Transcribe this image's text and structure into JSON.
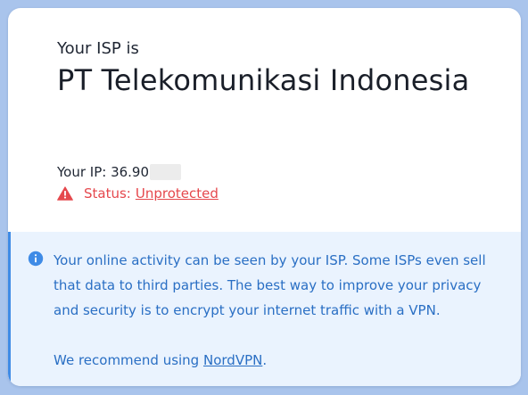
{
  "isp": {
    "label": "Your ISP is",
    "name": "PT Telekomunikasi Indonesia"
  },
  "ip": {
    "label": "Your IP: 36.90"
  },
  "status": {
    "label": "Status:",
    "value": "Unprotected",
    "icon": "warning-triangle-icon",
    "color": "#e5484d"
  },
  "info": {
    "icon": "info-circle-icon",
    "message": "Your online activity can be seen by your ISP. Some ISPs even sell that data to third parties. The best way to improve your privacy and security is to encrypt your internet traffic with a VPN.",
    "recommend_prefix": "We recommend using",
    "recommend_link": "NordVPN",
    "recommend_suffix": ".",
    "accent_color": "#3f8be6"
  }
}
